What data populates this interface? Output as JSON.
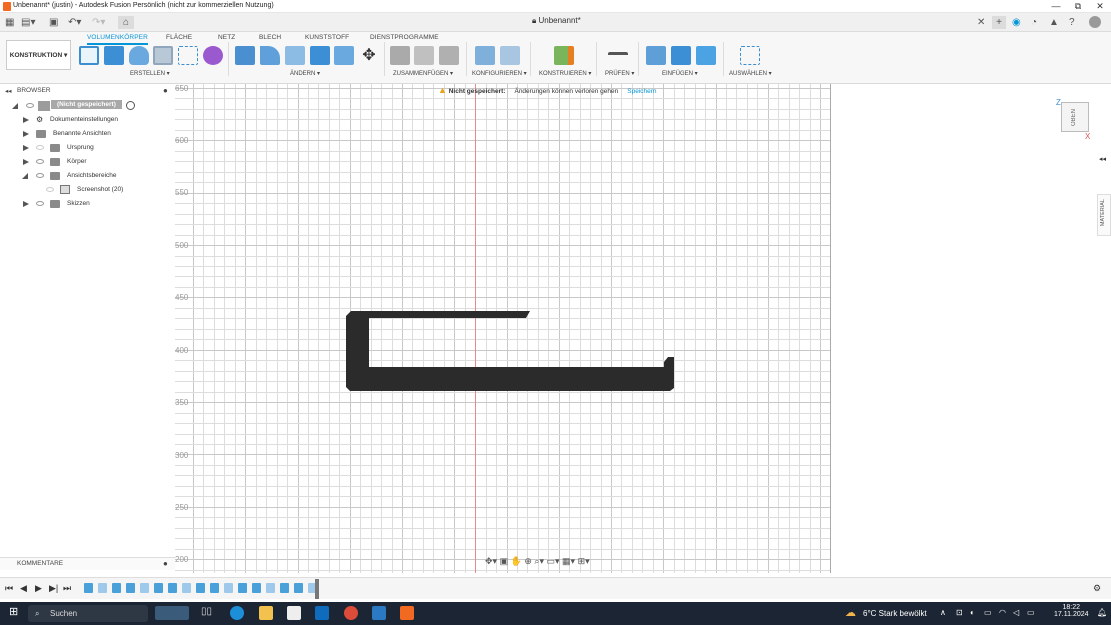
{
  "window": {
    "title": "Unbenannt* (justin) - Autodesk Fusion Persönlich (nicht zur kommerziellen Nutzung)",
    "min": "—",
    "max": "⧉",
    "close": "✕"
  },
  "document_tab": {
    "title": "Unbenannt*"
  },
  "ribbon": {
    "workspace": "KONSTRUKTION ▾",
    "tabs": [
      "VOLUMENKÖRPER",
      "FLÄCHE",
      "NETZ",
      "BLECH",
      "KUNSTSTOFF",
      "DIENSTPROGRAMME"
    ],
    "groups": [
      "ERSTELLEN ▾",
      "ÄNDERN ▾",
      "ZUSAMMENFÜGEN ▾",
      "KONFIGURIEREN ▾",
      "KONSTRUIEREN ▾",
      "PRÜFEN ▾",
      "EINFÜGEN ▾",
      "AUSWÄHLEN ▾"
    ]
  },
  "browser": {
    "header": "BROWSER",
    "root": "(Nicht gespeichert)",
    "items": [
      {
        "label": "Dokumenteinstellungen"
      },
      {
        "label": "Benannte Ansichten"
      },
      {
        "label": "Ursprung"
      },
      {
        "label": "Körper"
      },
      {
        "label": "Ansichtsbereiche"
      },
      {
        "label": "Screenshot (20)"
      },
      {
        "label": "Skizzen"
      }
    ]
  },
  "comments": {
    "label": "KOMMENTARE"
  },
  "canvas": {
    "warning_bold": "Nicht gespeichert:",
    "warning_text": "Änderungen können verloren gehen",
    "save_link": "Speichern",
    "y_ticks": [
      "650",
      "600",
      "550",
      "500",
      "450",
      "400",
      "350",
      "300",
      "250",
      "200"
    ],
    "shape_color": "#2b2b2b"
  },
  "viewcube": {
    "face": "OBEN",
    "axis_z": "Z",
    "axis_x": "X"
  },
  "right_panel": {
    "material": "MATERIAL"
  },
  "taskbar": {
    "search": "Suchen",
    "weather": "6°C  Stark bewölkt",
    "time": "18:22",
    "date": "17.11.2024"
  },
  "colors": {
    "accent": "#0696d7",
    "fusion_orange": "#f26a21",
    "taskbar": "#1c2533"
  }
}
